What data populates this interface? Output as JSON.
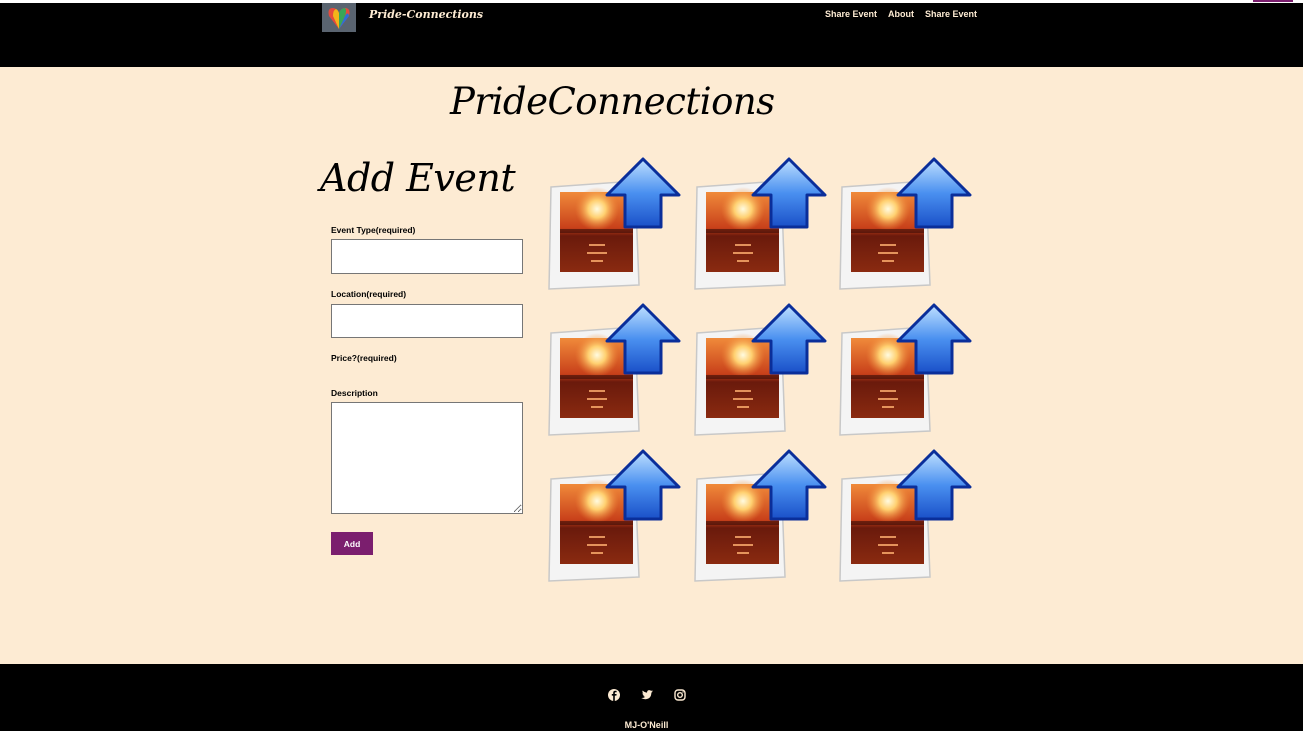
{
  "header": {
    "brand": "Pride-Connections",
    "nav": [
      "Share Event",
      "About",
      "Share Event"
    ]
  },
  "main": {
    "site_title": "PrideConnections",
    "page_heading": "Add Event",
    "form": {
      "event_type_label": "Event Type(required)",
      "event_type_value": "",
      "location_label": "Location(required)",
      "location_value": "",
      "price_label": "Price?(required)",
      "description_label": "Description",
      "description_value": "",
      "submit_label": "Add"
    },
    "image_tiles": [
      "upload-image-icon",
      "upload-image-icon",
      "upload-image-icon",
      "upload-image-icon",
      "upload-image-icon",
      "upload-image-icon",
      "upload-image-icon",
      "upload-image-icon",
      "upload-image-icon"
    ]
  },
  "footer": {
    "social": [
      "facebook-icon",
      "twitter-icon",
      "instagram-icon"
    ],
    "credit": "MJ-O'Neill"
  },
  "colors": {
    "background": "#fdebd3",
    "header": "#000000",
    "accent": "#7b1e6e",
    "header_text": "#fdebd3"
  }
}
